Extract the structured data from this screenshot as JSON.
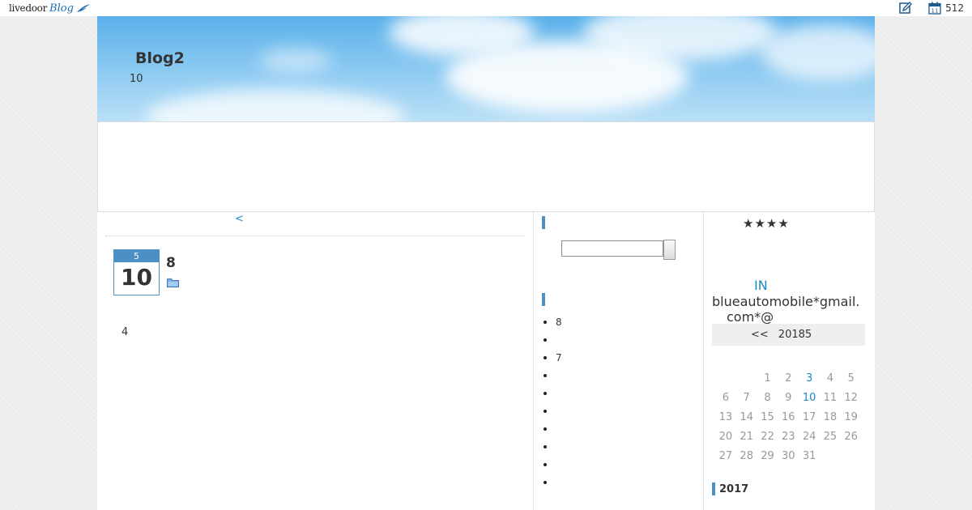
{
  "topbar": {
    "logo_text": "livedoor",
    "logo_blog": "Blog",
    "count": "512",
    "icons": [
      "edit-icon",
      "calendar-icon"
    ]
  },
  "header": {
    "title": "Blog2",
    "description": "10"
  },
  "main": {
    "prev_link": "<",
    "entry": {
      "month": "5",
      "day": "10",
      "title": "8",
      "body": "4"
    }
  },
  "sidebar_mid": {
    "recent_items": [
      "8",
      "",
      "7",
      "",
      "",
      "",
      "",
      "",
      "",
      ""
    ]
  },
  "sidebar_right": {
    "rating": "★★★★",
    "in_link": "IN",
    "email_line1": "blueautomobile*gmail.",
    "email_line2": "com*@",
    "calendar": {
      "prev_label": "<<",
      "month_label": "20185",
      "weeks": [
        [
          "",
          "",
          "1",
          "2",
          "3",
          "4",
          "5"
        ],
        [
          "6",
          "7",
          "8",
          "9",
          "10",
          "11",
          "12"
        ],
        [
          "13",
          "14",
          "15",
          "16",
          "17",
          "18",
          "19"
        ],
        [
          "20",
          "21",
          "22",
          "23",
          "24",
          "25",
          "26"
        ],
        [
          "27",
          "28",
          "29",
          "30",
          "31",
          "",
          ""
        ]
      ],
      "linked_days": [
        "3",
        "10"
      ]
    },
    "archive_label": "2017"
  },
  "colors": {
    "accent": "#4a90c4",
    "link": "#1d88c9",
    "sky_top": "#5ab0ea"
  }
}
